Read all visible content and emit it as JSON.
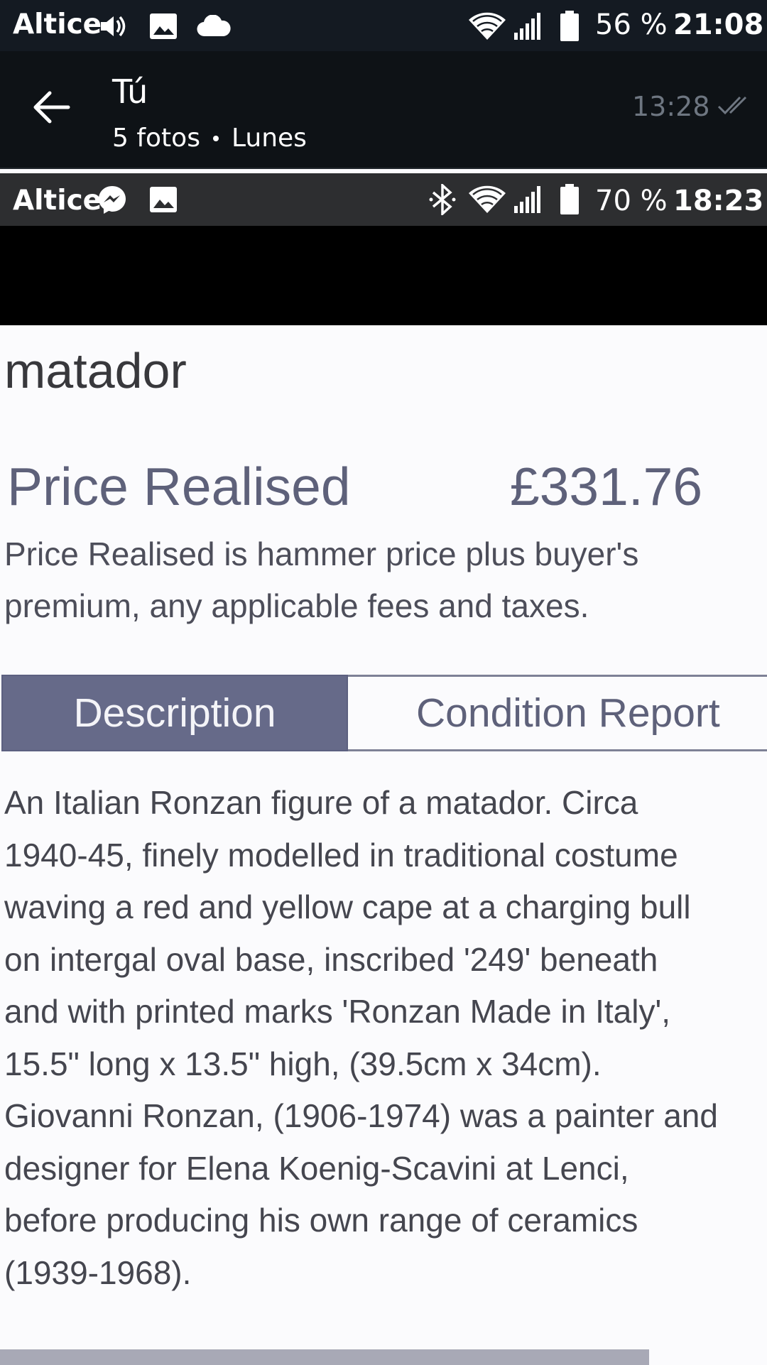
{
  "outer_status": {
    "carrier": "Altice",
    "battery_percent": "56 %",
    "time": "21:08",
    "icons": [
      "volume-icon",
      "image-icon",
      "cloud-icon",
      "wifi-icon",
      "signal-icon",
      "battery-icon"
    ]
  },
  "gallery_header": {
    "title": "Tú",
    "photo_count": "5 fotos",
    "day": "Lunes",
    "timestamp": "13:28"
  },
  "inner_status": {
    "carrier": "Altice",
    "battery_percent": "70 %",
    "time": "18:23",
    "icons": [
      "messenger-icon",
      "image-icon",
      "bluetooth-icon",
      "wifi-icon",
      "signal-icon",
      "battery-icon"
    ]
  },
  "lot": {
    "heading": "matador",
    "price_label": "Price Realised",
    "price_value": "£331.76",
    "price_note": "Price Realised is hammer price plus buyer's premium, any applicable fees and taxes.",
    "tabs": {
      "active": "Description",
      "inactive": "Condition Report"
    },
    "description_lines": [
      "An Italian Ronzan figure of a matador. Circa",
      "1940-45, finely modelled in traditional costume",
      "waving a red and yellow cape at a charging bull",
      "on intergal oval base, inscribed '249' beneath",
      "and with printed marks 'Ronzan Made in Italy',",
      "15.5\" long x 13.5\" high, (39.5cm x 34cm).",
      "Giovanni Ronzan, (1906-1974) was a painter and",
      "designer for Elena Koenig-Scavini at Lenci,",
      "before producing his own range of ceramics",
      "(1939-1968)."
    ]
  }
}
